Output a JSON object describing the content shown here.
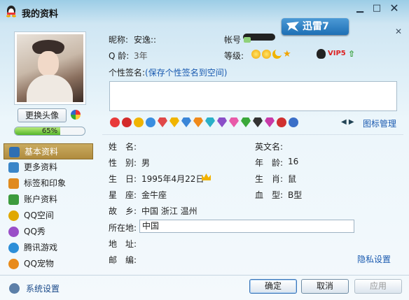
{
  "window": {
    "title": "我的资料",
    "minimize": "▁",
    "maximize": "□",
    "close": "✕"
  },
  "brand": {
    "label": "迅雷7",
    "close": "✕"
  },
  "profile": {
    "change_avatar": "更换头像",
    "progress_text": "65%",
    "progress_value": 0.65,
    "nickname_label": "昵称:",
    "nickname": "安逸::",
    "account_label": "帐号",
    "qage_label": "Q 龄:",
    "qage": "3年",
    "level_label": "等级:",
    "vip_label": "VIP5",
    "signature_label": "个性签名:",
    "signature_hint": "(保存个性签名到空间)",
    "icon_manage": "图标管理"
  },
  "nav": {
    "items": [
      {
        "label": "基本资料",
        "color": "#2f6fb3"
      },
      {
        "label": "更多资料",
        "color": "#3a86c8"
      },
      {
        "label": "标签和印象",
        "color": "#e08a1e"
      },
      {
        "label": "账户资料",
        "color": "#3d9b3d"
      },
      {
        "label": "QQ空间",
        "color": "#e0a800"
      },
      {
        "label": "QQ秀",
        "color": "#9a4fc8"
      },
      {
        "label": "腾讯游戏",
        "color": "#2c8ed8"
      },
      {
        "label": "QQ宠物",
        "color": "#e88a1a"
      }
    ],
    "settings": "系统设置"
  },
  "fields": {
    "name_label": "姓　名:",
    "english_name_label": "英文名:",
    "gender_label": "性　别:",
    "gender": "男",
    "age_label": "年　龄:",
    "age": "16",
    "birthday_label": "生　日:",
    "birthday": "1995年4月22日",
    "zodiac_label": "生　肖:",
    "zodiac": "鼠",
    "constellation_label": "星　座:",
    "constellation": "金牛座",
    "blood_label": "血　型:",
    "blood": "B型",
    "hometown_label": "故　乡:",
    "hometown": "中国  浙江  温州",
    "location_label": "所在地:",
    "location": "中国",
    "address_label": "地　址:",
    "postcode_label": "邮　编:",
    "privacy": "隐私设置"
  },
  "icons": [
    "heart-icon",
    "penguin-icon",
    "star-icon",
    "qq-plus-icon",
    "gem-red-icon",
    "gem-yellow-icon",
    "gem-blue-icon",
    "gem-orange-icon",
    "gem-cyan-icon",
    "gem-purple-icon",
    "gem-pink-icon",
    "gem-green-icon",
    "gem-black-icon",
    "gem-magenta-icon",
    "game-icon",
    "phone-icon"
  ],
  "icon_colors": [
    "#e83a3a",
    "#d32b2b",
    "#f0b400",
    "#3a8ee0",
    "#e04848",
    "#f0b400",
    "#3a86d8",
    "#f08a1a",
    "#2ab0c8",
    "#8a4fc8",
    "#e85aa8",
    "#3aa83a",
    "#333333",
    "#c83aa8",
    "#d03030",
    "#3a6fc8"
  ],
  "buttons": {
    "ok": "确定",
    "cancel": "取消",
    "apply": "应用"
  }
}
